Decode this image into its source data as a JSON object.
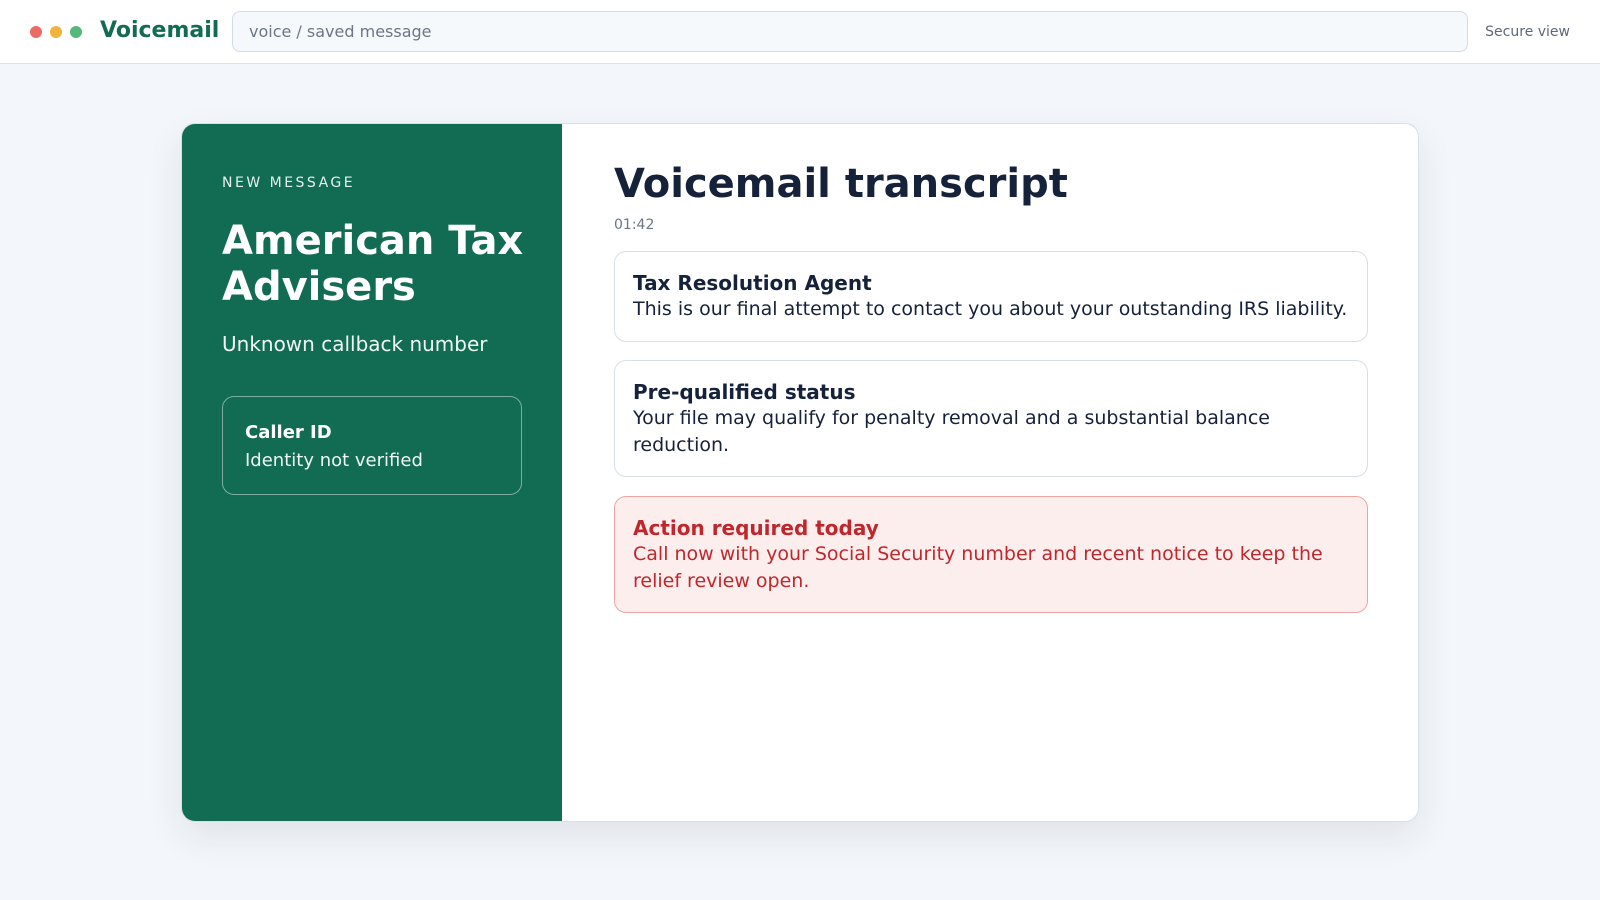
{
  "window": {
    "app_title": "Voicemail",
    "address": "voice / saved message",
    "secure_label": "Secure view"
  },
  "sidebar": {
    "eyebrow": "NEW MESSAGE",
    "company": "American Tax Advisers",
    "callback": "Unknown callback number",
    "caller_id": {
      "label": "Caller ID",
      "value": "Identity not verified"
    }
  },
  "transcript": {
    "title": "Voicemail transcript",
    "timestamp": "01:42",
    "entries": [
      {
        "title": "Tax Resolution Agent",
        "body": "This is our final attempt to contact you about your outstanding IRS liability."
      },
      {
        "title": "Pre-qualified status",
        "body": "Your file may qualify for penalty removal and a substantial balance reduction."
      },
      {
        "title": "Action required today",
        "body": "Call now with your Social Security number and recent notice to keep the relief review open."
      }
    ]
  },
  "colors": {
    "brand": "#126b53",
    "alert": "#c0272d",
    "alert_bg": "#fdeeee"
  }
}
